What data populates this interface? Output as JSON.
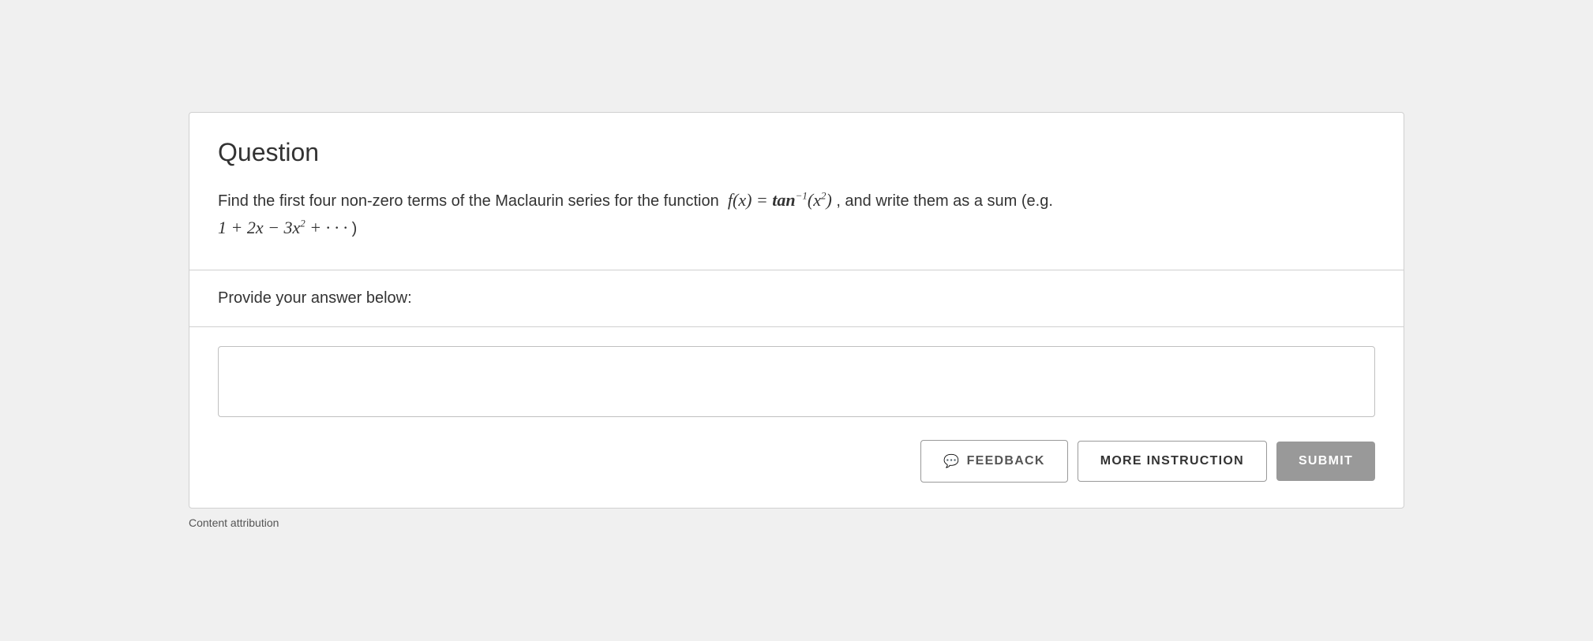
{
  "page": {
    "background_color": "#f0f0f0"
  },
  "card": {
    "question_section": {
      "title": "Question",
      "text_part1": "Find the first four non-zero terms of the Maclaurin series for the function",
      "formula_display": "f(x) = tan⁻¹(x²)",
      "text_part2": ", and write them as a sum (e.g.",
      "example_formula": "1 + 2x − 3x² + ···",
      "text_part3": ")"
    },
    "answer_label_section": {
      "label": "Provide your answer below:"
    },
    "answer_input_section": {
      "input_placeholder": ""
    },
    "buttons": {
      "feedback_label": "FEEDBACK",
      "feedback_icon": "💬",
      "more_instruction_label": "MORE INSTRUCTION",
      "submit_label": "SUBMIT"
    }
  },
  "footer": {
    "attribution": "Content attribution"
  }
}
